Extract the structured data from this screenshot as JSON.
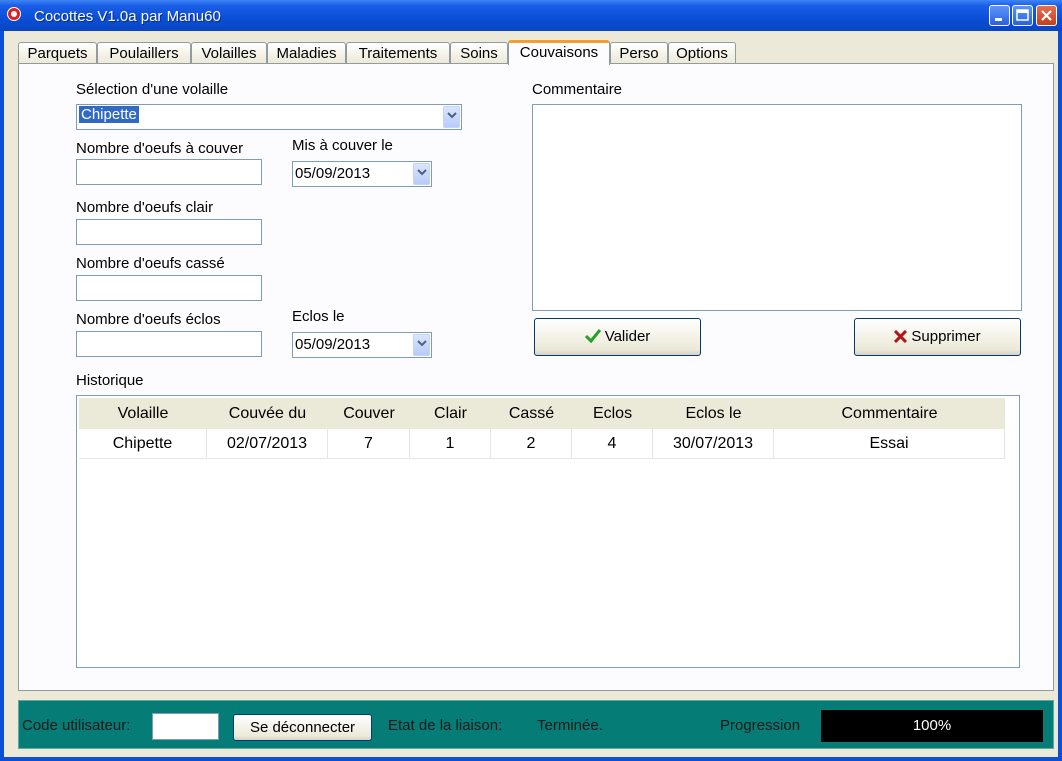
{
  "window": {
    "title": "Cocottes V1.0a par Manu60"
  },
  "tabs": [
    {
      "label": "Parquets"
    },
    {
      "label": "Poulaillers"
    },
    {
      "label": "Volailles"
    },
    {
      "label": "Maladies"
    },
    {
      "label": "Traitements"
    },
    {
      "label": "Soins"
    },
    {
      "label": "Couvaisons"
    },
    {
      "label": "Perso"
    },
    {
      "label": "Options"
    }
  ],
  "form": {
    "volaille_label": "Sélection d'une volaille",
    "volaille_value": "Chipette",
    "oeufs_couver_label": "Nombre d'oeufs à couver",
    "oeufs_couver_value": "",
    "mis_couver_label": "Mis à couver le",
    "mis_couver_value": "05/09/2013",
    "oeufs_clair_label": "Nombre d'oeufs clair",
    "oeufs_clair_value": "",
    "oeufs_casse_label": "Nombre d'oeufs cassé",
    "oeufs_casse_value": "",
    "oeufs_eclos_label": "Nombre d'oeufs éclos",
    "oeufs_eclos_value": "",
    "eclos_le_label": "Eclos le",
    "eclos_le_value": "05/09/2013",
    "commentaire_label": "Commentaire",
    "commentaire_value": "",
    "valider_label": "Valider",
    "supprimer_label": "Supprimer"
  },
  "historique": {
    "label": "Historique",
    "columns": [
      "Volaille",
      "Couvée du",
      "Couver",
      "Clair",
      "Cassé",
      "Eclos",
      "Eclos le",
      "Commentaire"
    ],
    "rows": [
      [
        "Chipette",
        "02/07/2013",
        "7",
        "1",
        "2",
        "4",
        "30/07/2013",
        "Essai"
      ]
    ]
  },
  "status": {
    "user_code_label": "Code utilisateur:",
    "user_code_value": "",
    "disconnect_label": "Se déconnecter",
    "link_state_label": "Etat de la liaison:",
    "link_state_value": "Terminée.",
    "progress_label": "Progression",
    "progress_value": "100%",
    "progress_fraction": 1.0
  },
  "colors": {
    "title_bar": "#0a4fd6",
    "status_bar": "#067c76",
    "accent_tab": "#f0a030",
    "valider_icon": "#2a9d2a",
    "supprimer_icon": "#b01818"
  }
}
